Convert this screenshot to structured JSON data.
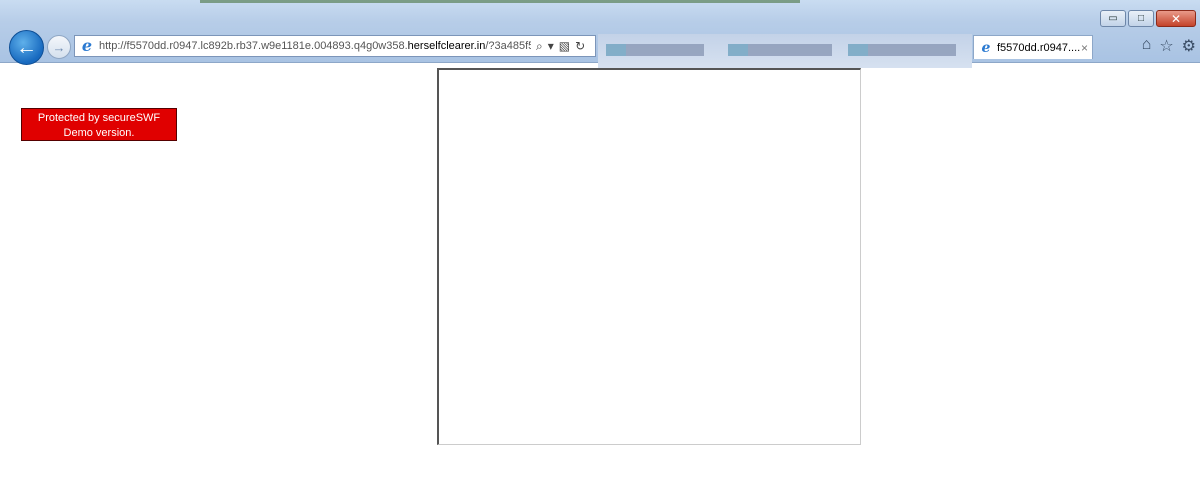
{
  "browser": {
    "address": {
      "url_prefix": "http://f5570dd.r0947.lc892b.rb37.w9e1181e.004893.q4g0w358.",
      "url_domain": "herselfclearer.in",
      "url_suffix": "/?3a485f5‹"
    },
    "active_tab": {
      "title": "f5570dd.r0947....",
      "close": "×"
    },
    "window_buttons": {
      "minimize": "▭",
      "maximize": "□",
      "close": "✕"
    },
    "toolbar_icons": {
      "home": "⌂",
      "favorites": "☆",
      "tools": "⚙"
    }
  },
  "page": {
    "badge": {
      "line1": "Protected by secureSWF",
      "line2": "Demo version."
    }
  },
  "colors": {
    "badge_bg": "#e00000",
    "back_button": "#1769bf"
  }
}
